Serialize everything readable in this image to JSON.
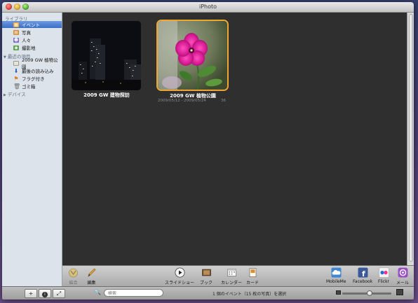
{
  "window": {
    "title": "iPhoto"
  },
  "sidebar": {
    "library_header": "ライブラリ",
    "library_items": [
      {
        "label": "イベント",
        "icon": "events-icon",
        "selected": true,
        "color": "#f2a22a"
      },
      {
        "label": "写真",
        "icon": "photos-icon",
        "selected": false,
        "color": "#d08b2e"
      },
      {
        "label": "人々",
        "icon": "faces-icon",
        "selected": false,
        "color": "#7b6fc0"
      },
      {
        "label": "撮影地",
        "icon": "places-icon",
        "selected": false,
        "color": "#5aa24c"
      }
    ],
    "recent_header": "最近の項目",
    "recent_items": [
      {
        "label": "2009 GW 植物公園",
        "icon": "event-album-icon",
        "color": "#e9e3cf"
      },
      {
        "label": "最後の読み込み",
        "icon": "import-icon",
        "color": "#4a6fb5"
      },
      {
        "label": "フラグ付き",
        "icon": "flag-icon",
        "color": "#e27b22"
      },
      {
        "label": "ゴミ箱",
        "icon": "trash-icon",
        "color": "#8c8c8c"
      }
    ],
    "devices_header": "デバイス"
  },
  "events": [
    {
      "title": "2009 GW 建物探訪",
      "meta_left": "",
      "meta_right": "",
      "selected": false
    },
    {
      "title": "2009 GW 植物公園",
      "meta_left": "2009/05/12 - 2009/05/24",
      "meta_right": "36",
      "selected": true
    }
  ],
  "toolbar": {
    "left": [
      {
        "label": "結合",
        "icon": "merge-icon"
      },
      {
        "label": "編集",
        "icon": "edit-pencil-icon"
      }
    ],
    "center": [
      {
        "label": "スライドショー",
        "icon": "slideshow-play-icon"
      },
      {
        "label": "ブック",
        "icon": "book-icon"
      },
      {
        "label": "カレンダー",
        "icon": "calendar-icon"
      },
      {
        "label": "カード",
        "icon": "card-icon"
      }
    ],
    "right": [
      {
        "label": "MobileMe",
        "icon": "mobileme-icon"
      },
      {
        "label": "Facebook",
        "icon": "facebook-icon"
      },
      {
        "label": "Flickr",
        "icon": "flickr-icon"
      },
      {
        "label": "メール",
        "icon": "mail-icon"
      }
    ]
  },
  "bottombar": {
    "add_label": "+",
    "info_label": "i",
    "fullscreen_label": "⤢",
    "search_placeholder": "検索",
    "status_text": "1 個のイベント（15 枚の写真）を選択",
    "zoom_level": 0.55
  },
  "colors": {
    "selection_border": "#f0a632",
    "sidebar_selection": "#3a6ec6"
  }
}
